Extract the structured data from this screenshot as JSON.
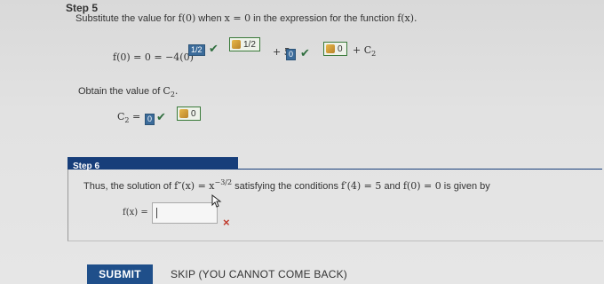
{
  "step5": {
    "title": "Step 5",
    "instruction_pre": "Substitute the value for",
    "instruction_fn": "f(0)",
    "instruction_mid": "when",
    "instruction_cond": "x = 0",
    "instruction_post": "in the expression for the function",
    "instruction_fx": "f(x).",
    "eq_lhs": "f(0) = 0 = −4(0)",
    "exp_value": "1/2",
    "answer1": "1/2",
    "plus5": "+ 5",
    "filled_zero": "0",
    "answer2": "0",
    "plus_c": "+ C",
    "c_sub": "2",
    "obtain_text": "Obtain the value of",
    "obtain_var": "C",
    "obtain_sub": "2",
    "obtain_dot": ".",
    "c2_lhs": "C",
    "c2_sub": "2",
    "c2_eq": "=",
    "c2_filled": "0",
    "answer3": "0"
  },
  "step6": {
    "title": "Step 6",
    "text_pre": "Thus, the solution of",
    "fpp": "f″(x) = x",
    "fpp_exp": "−3/2",
    "text_mid": "satisfying the conditions",
    "cond1": "f′(4) = 5",
    "and": "and",
    "cond2": "f(0) = 0",
    "text_post": "is given by",
    "fx_label": "f(x) =",
    "input_value": "",
    "wrong_mark": "×"
  },
  "buttons": {
    "submit": "SUBMIT",
    "skip": "SKIP (YOU CANNOT COME BACK)"
  },
  "colors": {
    "header_blue": "#173e7a",
    "submit_blue": "#1f4f8a",
    "check_green": "#2f6e3e",
    "wrong_red": "#c0392b"
  }
}
